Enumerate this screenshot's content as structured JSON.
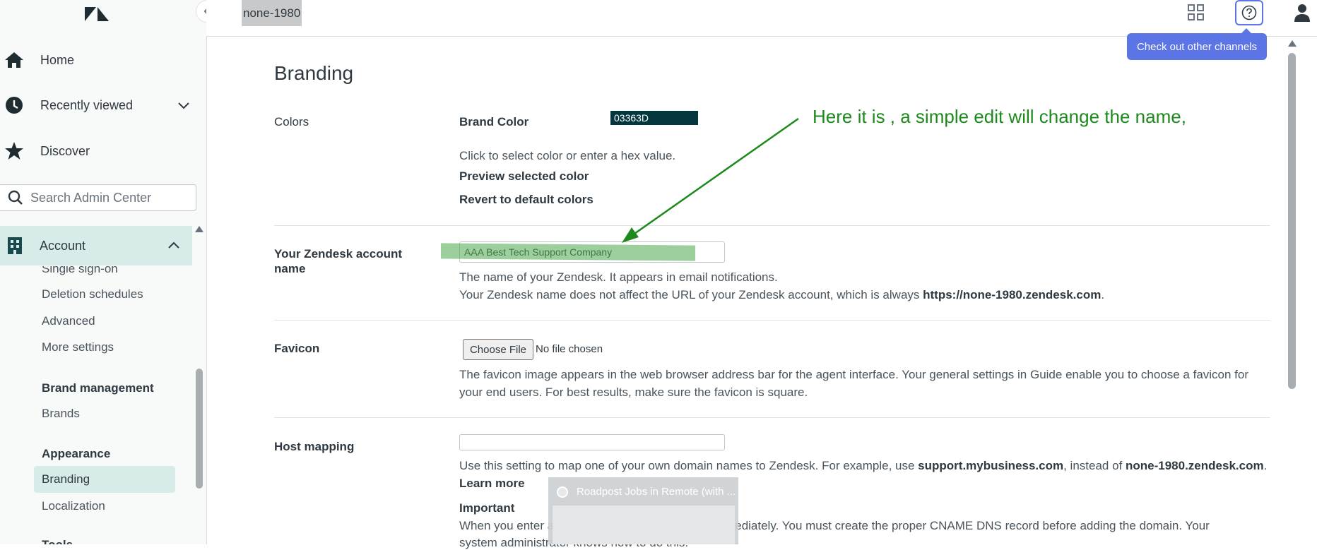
{
  "sidebar": {
    "nav": [
      {
        "label": "Home",
        "icon": "home-icon"
      },
      {
        "label": "Recently viewed",
        "icon": "clock-icon"
      },
      {
        "label": "Discover",
        "icon": "star-icon"
      }
    ],
    "search_placeholder": "Search Admin Center",
    "account_label": "Account",
    "account_items": [
      "Single sign-on",
      "Deletion schedules",
      "Advanced",
      "More settings"
    ],
    "brand_management_heading": "Brand management",
    "brands_label": "Brands",
    "appearance_heading": "Appearance",
    "branding_label": "Branding",
    "localization_label": "Localization",
    "tools_heading": "Tools"
  },
  "topbar": {
    "account_tag": "none-1980",
    "tooltip": "Check out other channels"
  },
  "main": {
    "title": "Branding",
    "colors": {
      "label": "Colors",
      "brand_color_label": "Brand Color",
      "brand_color_value": "03363D",
      "brand_color_hex": "#03363D",
      "help": "Click to select color or enter a hex value.",
      "preview_link": "Preview selected color",
      "revert_link": "Revert to default colors"
    },
    "account_name": {
      "label_line1": "Your Zendesk account",
      "label_line2": "name",
      "value": "AAA Best Tech Support Company",
      "help1": "The name of your Zendesk. It appears in email notifications.",
      "help2_pre": "Your Zendesk name does not affect the URL of your Zendesk account, which is always ",
      "help2_url": "https://none-1980.zendesk.com",
      "help2_post": "."
    },
    "favicon": {
      "label": "Favicon",
      "choose_button": "Choose File",
      "no_file": "No file chosen",
      "help1": "The favicon image appears in the web browser address bar for the agent interface. Your general settings in Guide enable you to choose a favicon for",
      "help2": "your end users. For best results, make sure the favicon is square."
    },
    "host_mapping": {
      "label": "Host mapping",
      "value": "",
      "help_pre": "Use this setting to map one of your own domain names to Zendesk. For example, use ",
      "help_example": "support.mybusiness.com",
      "help_mid": ", instead of ",
      "help_default": "none-1980.zendesk.com",
      "help_post": ".",
      "learn_more": "Learn more",
      "important_heading": "Important",
      "important_text": "When you enter a domain name, it will be used immediately. You must create the proper CNAME DNS record before adding the domain. Your",
      "important_text2": "system administrator knows how to do this."
    }
  },
  "annotation": {
    "text": "Here it is , a simple edit will change the name,",
    "color": "#1e8a1e"
  },
  "popup": {
    "title": "Roadpost Jobs in Remote (with ..."
  }
}
